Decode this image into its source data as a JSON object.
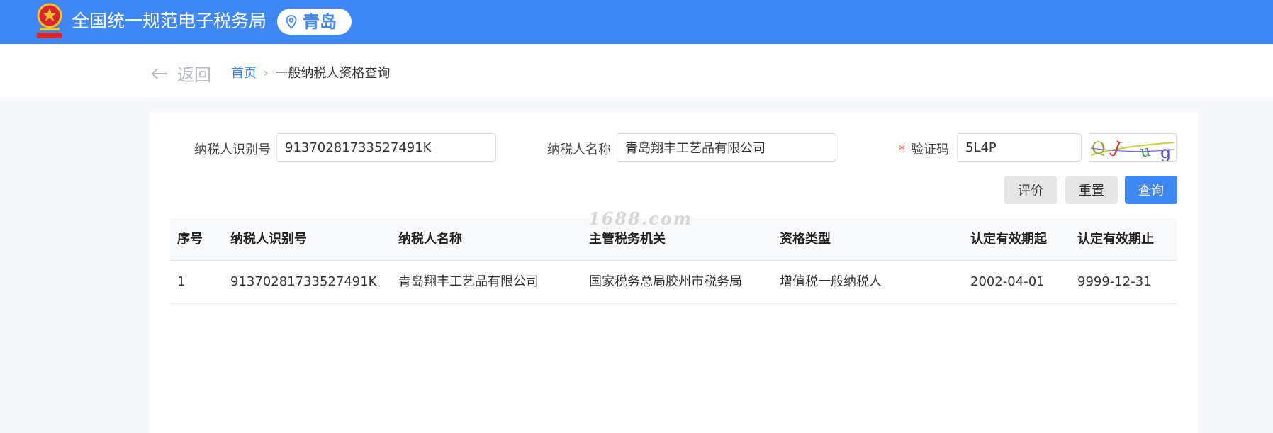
{
  "header": {
    "emblem_text": "国家税务总局",
    "site_title": "全国统一规范电子税务局",
    "city": "青岛"
  },
  "nav": {
    "back_label": "返回",
    "breadcrumb_home": "首页",
    "breadcrumb_current": "一般纳税人资格查询"
  },
  "form": {
    "taxpayer_id_label": "纳税人识别号",
    "taxpayer_id_value": "91370281733527491K",
    "taxpayer_name_label": "纳税人名称",
    "taxpayer_name_value": "青岛翔丰工艺品有限公司",
    "captcha_required_mark": "*",
    "captcha_label": "验证码",
    "captcha_value": "5L4P",
    "captcha_image_text": "Q/Jug"
  },
  "buttons": {
    "evaluate": "评价",
    "reset": "重置",
    "query": "查询"
  },
  "table": {
    "columns": [
      "序号",
      "纳税人识别号",
      "纳税人名称",
      "主管税务机关",
      "资格类型",
      "认定有效期起",
      "认定有效期止"
    ],
    "rows": [
      [
        "1",
        "91370281733527491K",
        "青岛翔丰工艺品有限公司",
        "国家税务总局胶州市税务局",
        "增值税一般纳税人",
        "2002-04-01",
        "9999-12-31"
      ]
    ]
  },
  "watermark": "1688.com",
  "colors": {
    "primary": "#3f87f5",
    "header_bg": "#3f87f5",
    "required": "#e74c3c"
  }
}
